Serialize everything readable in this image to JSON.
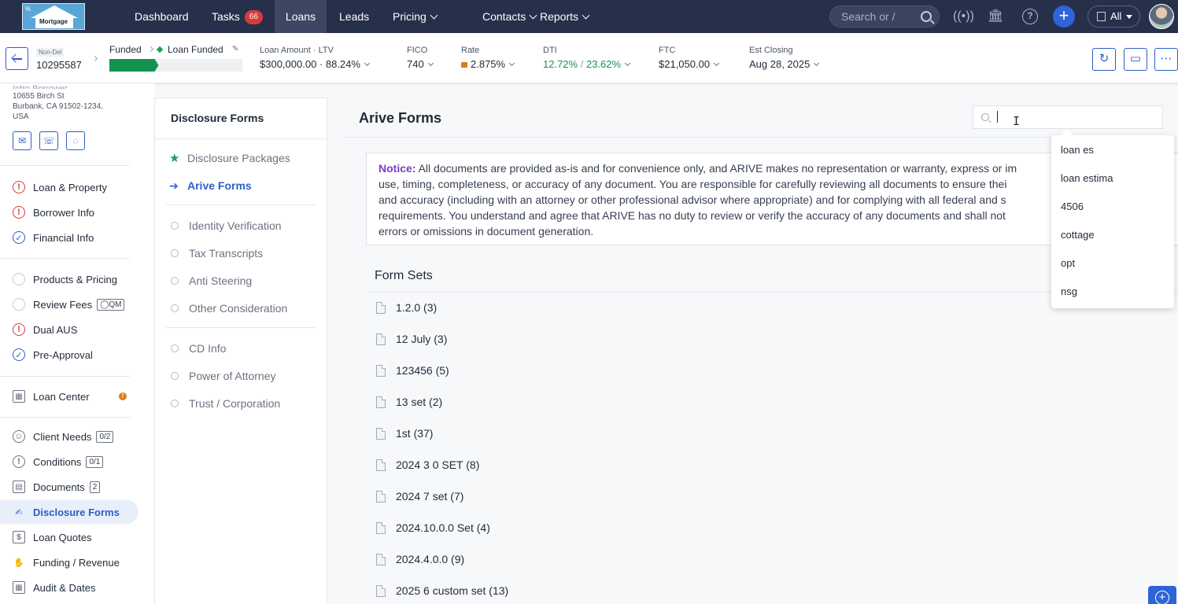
{
  "brand": {
    "logo_text": "Mortgage",
    "logo_mark": "%"
  },
  "nav": {
    "items": [
      {
        "label": "Dashboard"
      },
      {
        "label": "Tasks",
        "badge": "66"
      },
      {
        "label": "Loans"
      },
      {
        "label": "Leads"
      },
      {
        "label": "Pricing"
      },
      {
        "label": "Contacts"
      },
      {
        "label": "Reports"
      }
    ],
    "active": "Loans",
    "search_placeholder": "Search or /",
    "scope_label": "All",
    "icons": [
      "broadcast-icon",
      "bank-icon",
      "help-icon",
      "plus-icon",
      "building-icon",
      "user-avatar"
    ]
  },
  "loan": {
    "program": "Non-Del",
    "number": "10295587",
    "stage": "Funded",
    "status": "Loan Funded",
    "progress": 0.37,
    "stats": [
      {
        "label": "Loan Amount",
        "label2": "LTV",
        "value": "$300,000.00",
        "value2": "88.24%"
      },
      {
        "label": "FICO",
        "value": "740"
      },
      {
        "label": "Rate",
        "value": "2.875%"
      },
      {
        "label": "DTI",
        "value": "12.72%",
        "value2": "23.62%"
      },
      {
        "label": "FTC",
        "value": "$21,050.00"
      },
      {
        "label": "Est Closing",
        "value": "Aug 28, 2025"
      }
    ]
  },
  "borrower": {
    "name_partial": "Intro Borrower",
    "address_line1": "10655 Birch St",
    "address_line2": "Burbank, CA 91502-1234,",
    "address_line3": "USA"
  },
  "sidebar": {
    "group1": [
      {
        "label": "Loan & Property",
        "status": "warn"
      },
      {
        "label": "Borrower Info",
        "status": "warn"
      },
      {
        "label": "Financial Info",
        "status": "ok"
      }
    ],
    "group2": [
      {
        "label": "Products & Pricing",
        "status": "empty"
      },
      {
        "label": "Review Fees",
        "status": "empty",
        "tag": "QM"
      },
      {
        "label": "Dual AUS",
        "status": "warn"
      },
      {
        "label": "Pre-Approval",
        "status": "ok"
      }
    ],
    "loan_center": {
      "label": "Loan Center",
      "dot": "!"
    },
    "group3": [
      {
        "label": "Client Needs",
        "count": "0/2"
      },
      {
        "label": "Conditions",
        "count": "0/1"
      },
      {
        "label": "Documents",
        "count": "2"
      },
      {
        "label": "Disclosure Forms",
        "active": true
      },
      {
        "label": "Loan Quotes"
      },
      {
        "label": "Funding / Revenue"
      },
      {
        "label": "Audit & Dates"
      }
    ]
  },
  "disclosure_panel": {
    "title": "Disclosure Forms",
    "items": [
      {
        "label": "Disclosure Packages"
      },
      {
        "label": "Arive Forms",
        "active": true
      },
      {
        "label": "Identity Verification"
      },
      {
        "label": "Tax Transcripts"
      },
      {
        "label": "Anti Steering"
      },
      {
        "label": "Other Consideration"
      },
      {
        "label": "CD Info"
      },
      {
        "label": "Power of Attorney"
      },
      {
        "label": "Trust / Corporation"
      }
    ]
  },
  "main": {
    "title": "Arive Forms",
    "search_value": "",
    "notice_label": "Notice:",
    "notice_lines": [
      "All documents are provided as-is and for convenience only, and ARIVE makes no representation or warranty, express or im",
      "use, timing, completeness, or accuracy of any document. You are responsible for carefully reviewing all documents to ensure thei",
      "and accuracy (including with an attorney or other professional advisor where appropriate) and for complying with all federal and s",
      "requirements. You understand and agree that ARIVE has no duty to review or verify the accuracy of any documents and shall not",
      "errors or omissions in document generation."
    ],
    "form_sets_title": "Form Sets",
    "form_sets": [
      "1.2.0 (3)",
      "12 July (3)",
      "123456 (5)",
      "13 set (2)",
      "1st (37)",
      "2024 3 0 SET (8)",
      "2024 7 set (7)",
      "2024.10.0.0 Set (4)",
      "2024.4.0.0 (9)",
      "2025 6 custom set (13)"
    ]
  },
  "search_suggestions": [
    "loan es",
    "loan estima",
    "4506",
    "cottage",
    "opt",
    "nsg"
  ],
  "colors": {
    "nav_bg": "#27304a",
    "accent": "#2d5fc7",
    "success": "#14934f",
    "warning": "#d63b3b",
    "notice_label": "#7b3fc4"
  }
}
